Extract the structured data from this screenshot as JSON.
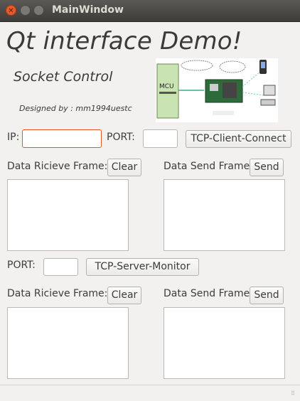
{
  "window": {
    "title": "MainWindow"
  },
  "header": {
    "title": "Qt interface Demo!",
    "subtitle": "Socket Control",
    "credit": "Designed by : mm1994uestc"
  },
  "client": {
    "ip_label": "IP:",
    "ip_value": "",
    "port_label": "PORT:",
    "port_value": "",
    "connect_label": "TCP-Client-Connect",
    "recv_label": "Data Ricieve Frame:",
    "clear_label": "Clear",
    "send_frame_label": "Data Send Frame:",
    "send_label": "Send"
  },
  "server": {
    "port_label": "PORT:",
    "port_value": "",
    "monitor_label": "TCP-Server-Monitor",
    "recv_label": "Data Ricieve Frame:",
    "clear_label": "Clear",
    "send_frame_label": "Data Send Frame:",
    "send_label": "Send"
  },
  "diagram": {
    "mcu_label": "MCU"
  }
}
